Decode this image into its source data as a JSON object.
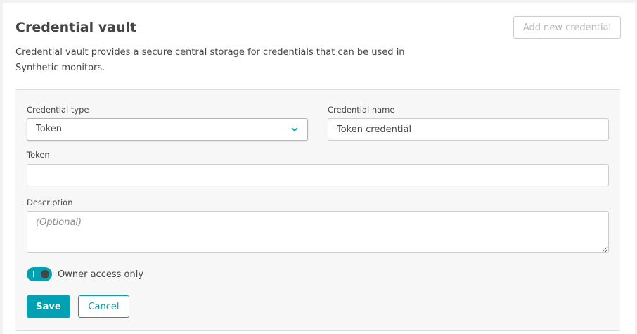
{
  "header": {
    "title": "Credential vault",
    "add_button_label": "Add new credential",
    "description": "Credential vault provides a secure central storage for credentials that can be used in Synthetic monitors."
  },
  "form": {
    "credential_type": {
      "label": "Credential type",
      "selected": "Token"
    },
    "credential_name": {
      "label": "Credential name",
      "value": "Token credential"
    },
    "token": {
      "label": "Token",
      "value": ""
    },
    "description": {
      "label": "Description",
      "placeholder": "(Optional)"
    },
    "owner_access": {
      "label": "Owner access only",
      "enabled": true
    },
    "save_label": "Save",
    "cancel_label": "Cancel"
  },
  "colors": {
    "accent": "#00a1b2",
    "text": "#454646",
    "disabled_text": "#b7b7b7"
  },
  "icons": {
    "select_arrow": "chevron-down-icon"
  }
}
